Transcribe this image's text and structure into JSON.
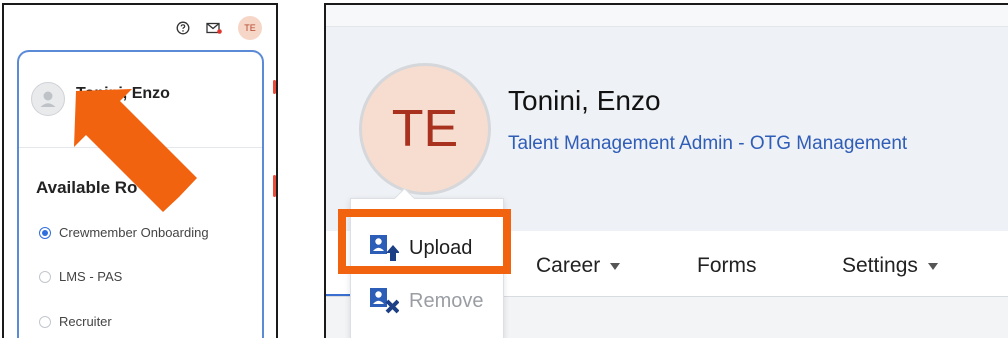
{
  "left_panel": {
    "header": {
      "help_icon": "help-circle-icon",
      "mail_icon": "mail-notification-icon",
      "avatar_initials": "TE"
    },
    "user_name": "Tonini, Enzo",
    "roles_heading": "Available Ro",
    "roles": [
      {
        "label": "Crewmember Onboarding",
        "selected": true
      },
      {
        "label": "LMS - PAS",
        "selected": false
      },
      {
        "label": "Recruiter",
        "selected": false
      }
    ],
    "annotation_color": "#f2630f"
  },
  "right_panel": {
    "avatar_initials": "TE",
    "name": "Tonini, Enzo",
    "subtitle": "Talent Management Admin - OTG Management",
    "photo_menu": {
      "upload_label": "Upload",
      "remove_label": "Remove"
    },
    "nav": {
      "career_label": "Career",
      "forms_label": "Forms",
      "settings_label": "Settings"
    },
    "highlight_color": "#f2630f",
    "accent_color": "#2f5db8"
  }
}
